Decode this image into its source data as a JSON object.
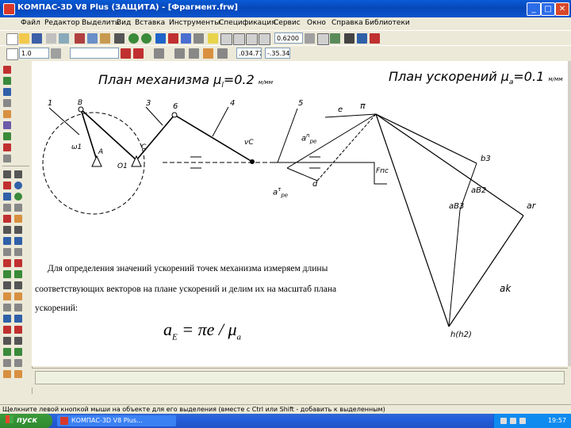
{
  "window": {
    "title": "КОМПАС-3D V8 Plus (ЗАЩИТА) - [Фрагмент.frw]",
    "minimize_icon": "minimize-icon",
    "maximize_icon": "maximize-icon",
    "close_icon": "close-icon",
    "close_glyph": "✕",
    "minimize_glyph": "_",
    "maximize_glyph": "□"
  },
  "menu": [
    "Файл",
    "Редактор",
    "Выделить",
    "Вид",
    "Вставка",
    "Инструменты",
    "Спецификация",
    "Сервис",
    "Окно",
    "Справка",
    "Библиотеки"
  ],
  "toolbar1": {
    "zoom_value": "0.6200"
  },
  "toolbar2": {
    "style_value": "1.0",
    "coord_x": ".034.77",
    "coord_y": "-.35.34"
  },
  "drawing": {
    "mechanism_title": "План механизма",
    "mechanism_scale": "μ",
    "mechanism_scale_sub": "l",
    "mechanism_scale_value": "=0.2",
    "mechanism_units": "м/мм",
    "accel_title": "План ускорений",
    "accel_scale": "μ",
    "accel_scale_sub": "a",
    "accel_scale_value": "=0.1",
    "accel_units": "м/мм",
    "link_numbers": [
      "1",
      "3",
      "4",
      "5",
      "6"
    ],
    "labels": {
      "point_b": "B",
      "point_a": "A",
      "point_c": "C",
      "omega": "ω1",
      "o1": "O1",
      "vc": "vC",
      "e_star": "e",
      "pi": "π",
      "a_n_pe": "a",
      "a_n_pe_sup": "n",
      "a_n_pe_sub": "pe",
      "a_tau_pe": "a",
      "a_tau_pe_sup": "τ",
      "a_tau_pe_sub": "pe",
      "d": "d",
      "f_pc": "Fпс",
      "b3": "b3",
      "a_b2": "aB2",
      "a_b3": "aB3",
      "a_r": "ar",
      "a_k": "ak",
      "h_h2": "h(h2)"
    }
  },
  "text": {
    "para1": "Для определения значений ускорений точек механизма измеряем длины",
    "para2": "соответствующих векторов на плане ускорений и делим их на масштаб плана",
    "para3": "ускорений:",
    "formula_lhs": "a",
    "formula_sub": "E",
    "formula_rhs": " = πe / μ",
    "formula_rhs_sub": "a"
  },
  "status": {
    "hint": "Щелкните левой кнопкой мыши на объекте для его выделения (вместе с Ctrl или Shift - добавить к выделенным)"
  },
  "taskbar": {
    "start_label": "пуск",
    "task_label": "КОМПАС-3D V8 Plus...",
    "clock": "19:57"
  }
}
